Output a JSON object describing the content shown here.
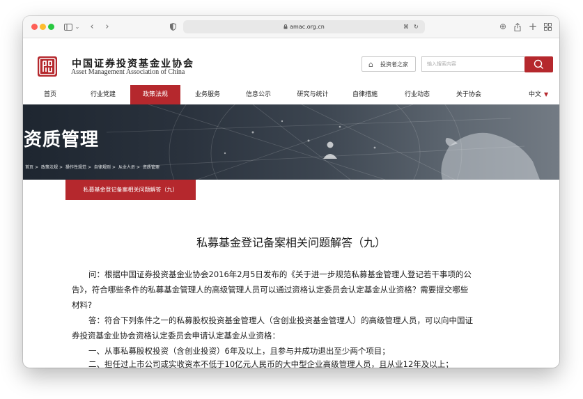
{
  "browser": {
    "url": "amac.org.cn",
    "traffic_lights": {
      "close": "#fe5f57",
      "minimize": "#febc2e",
      "zoom": "#28c840"
    }
  },
  "header": {
    "org_name_cn": "中国证券投资基金业协会",
    "org_name_en": "Asset Management Association of China",
    "investor_button": "投资者之家",
    "search_placeholder": "输入搜索内容",
    "brand_color": "#b5282d"
  },
  "nav": {
    "items": [
      {
        "label": "首页"
      },
      {
        "label": "行业党建"
      },
      {
        "label": "政策法规",
        "active": true
      },
      {
        "label": "业务服务"
      },
      {
        "label": "信息公示"
      },
      {
        "label": "研究与统计"
      },
      {
        "label": "自律措施"
      },
      {
        "label": "行业动态"
      },
      {
        "label": "关于协会"
      }
    ],
    "language": "中文"
  },
  "banner": {
    "title": "资质管理",
    "breadcrumb": [
      "首页",
      "政策法规",
      "操作性规范",
      "自律规则",
      "从业人员",
      "资质管理"
    ]
  },
  "tab": {
    "label": "私募基金登记备案相关问题解答（九）"
  },
  "article": {
    "title": "私募基金登记备案相关问题解答（九）",
    "lines": [
      "问：根据中国证券投资基金业协会2016年2月5日发布的《关于进一步规范私募基金管理人登记若干事项的公",
      "告》，符合哪些条件的私募基金管理人的高级管理人员可以通过资格认定委员会认定基金从业资格？需要提交哪些",
      "材料?",
      "答：符合下列条件之一的私募股权投资基金管理人（含创业投资基金管理人）的高级管理人员，可以向中国证",
      "券投资基金业协会资格认定委员会申请认定基金从业资格：",
      "一、从事私募股权投资（含创业投资）6年及以上，且参与并成功退出至少两个项目；",
      "二、担任过上市公司或实收资本不低于10亿元人民币的大中型企业高级管理人员，且从业12年及以上；"
    ]
  }
}
